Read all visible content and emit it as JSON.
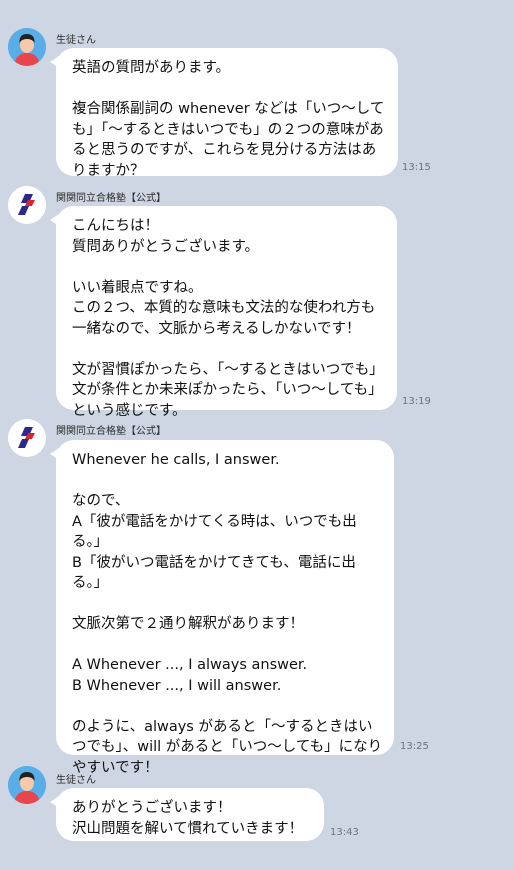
{
  "messages": [
    {
      "sender": "生徒さん",
      "time": "13:15",
      "lines": [
        "英語の質問があります。",
        "",
        "複合関係副詞の whenever などは「いつ～して",
        "も」「～するときはいつでも」の２つの意味があ",
        "ると思うのですが、これらを見分ける方法はあ",
        "りますか？"
      ]
    },
    {
      "sender": "関関同立合格塾【公式】",
      "time": "13:19",
      "lines": [
        "こんにちは！",
        "質問ありがとうございます。",
        "",
        "いい着眼点ですね。",
        "この２つ、本質的な意味も文法的な使われ方も",
        "一緒なので、文脈から考えるしかないです！",
        "",
        "文が習慣ぽかったら、「～するときはいつでも」",
        "文が条件とか未来ぽかったら、「いつ～しても」",
        "という感じです。"
      ]
    },
    {
      "sender": "関関同立合格塾【公式】",
      "time": "13:25",
      "lines": [
        "Whenever he calls, I answer.",
        "",
        "なので、",
        "A「彼が電話をかけてくる時は、いつでも出",
        "る。」",
        "B「彼がいつ電話をかけてきても、電話に出",
        "る。」",
        "",
        "文脈次第で２通り解釈があります！",
        "",
        "A Whenever ..., I always answer.",
        "B Whenever ..., I will answer.",
        "",
        "のように、always があると「～するときはい",
        "つでも」、will があると「いつ～しても」になり",
        "やすいです！"
      ]
    },
    {
      "sender": "生徒さん",
      "time": "13:43",
      "lines": [
        "ありがとうございます！",
        "沢山問題を解いて慣れていきます！"
      ]
    }
  ],
  "colors": {
    "background": "#cdd6e2",
    "bubble": "#ffffff",
    "student_avatar_bg": "#5aaee8",
    "student_shirt": "#e8454c",
    "school_logo_navy": "#2b2a8a",
    "school_logo_red": "#d8262c"
  }
}
